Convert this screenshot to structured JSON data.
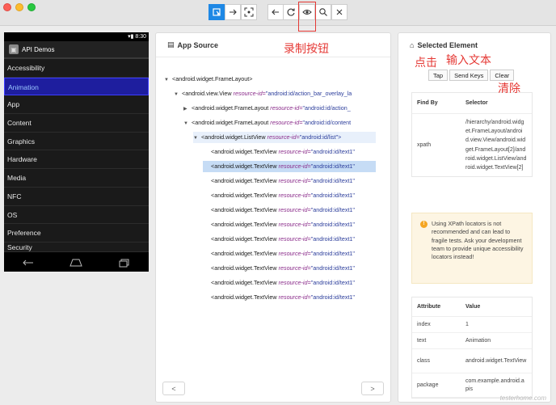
{
  "toolbar": {
    "buttons": [
      {
        "name": "select-elements",
        "icon": "select-icon",
        "active": true
      },
      {
        "name": "swipe",
        "icon": "arrow-right-icon"
      },
      {
        "name": "tap-coordinates",
        "icon": "crosshair-icon"
      },
      {
        "name": "back",
        "icon": "back-arrow-icon"
      },
      {
        "name": "refresh",
        "icon": "refresh-icon"
      },
      {
        "name": "recorder",
        "icon": "eye-icon"
      },
      {
        "name": "search",
        "icon": "search-icon"
      },
      {
        "name": "quit",
        "icon": "close-icon"
      }
    ]
  },
  "device": {
    "status_time": "8:30",
    "app_title": "API Demos",
    "items": [
      "Accessibility",
      "Animation",
      "App",
      "Content",
      "Graphics",
      "Hardware",
      "Media",
      "NFC",
      "OS",
      "Preference",
      "Security"
    ],
    "selected_index": 1
  },
  "source": {
    "title": "App Source",
    "nodes": [
      {
        "caret": "▼",
        "tag": "<android.widget.FrameLayout>",
        "attr": "",
        "val": ""
      },
      {
        "caret": "▼",
        "tag": "<android.view.View ",
        "attr": "resource-id=",
        "val": "\"android:id/action_bar_overlay_la"
      },
      {
        "caret": "▶",
        "tag": "<android.widget.FrameLayout ",
        "attr": "resource-id=",
        "val": "\"android:id/action_"
      },
      {
        "caret": "▼",
        "tag": "<android.widget.FrameLayout ",
        "attr": "resource-id=",
        "val": "\"android:id/content"
      },
      {
        "caret": "▼",
        "tag": "<android.widget.ListView ",
        "attr": "resource-id=",
        "val": "\"android:id/list\">"
      },
      {
        "caret": "",
        "tag": "<android.widget.TextView ",
        "attr": "resource-id=",
        "val": "\"android:id/text1\""
      },
      {
        "caret": "",
        "tag": "<android.widget.TextView ",
        "attr": "resource-id=",
        "val": "\"android:id/text1\""
      },
      {
        "caret": "",
        "tag": "<android.widget.TextView ",
        "attr": "resource-id=",
        "val": "\"android:id/text1\""
      },
      {
        "caret": "",
        "tag": "<android.widget.TextView ",
        "attr": "resource-id=",
        "val": "\"android:id/text1\""
      },
      {
        "caret": "",
        "tag": "<android.widget.TextView ",
        "attr": "resource-id=",
        "val": "\"android:id/text1\""
      },
      {
        "caret": "",
        "tag": "<android.widget.TextView ",
        "attr": "resource-id=",
        "val": "\"android:id/text1\""
      },
      {
        "caret": "",
        "tag": "<android.widget.TextView ",
        "attr": "resource-id=",
        "val": "\"android:id/text1\""
      },
      {
        "caret": "",
        "tag": "<android.widget.TextView ",
        "attr": "resource-id=",
        "val": "\"android:id/text1\""
      },
      {
        "caret": "",
        "tag": "<android.widget.TextView ",
        "attr": "resource-id=",
        "val": "\"android:id/text1\""
      },
      {
        "caret": "",
        "tag": "<android.widget.TextView ",
        "attr": "resource-id=",
        "val": "\"android:id/text1\""
      },
      {
        "caret": "",
        "tag": "<android.widget.TextView ",
        "attr": "resource-id=",
        "val": "\"android:id/text1\""
      }
    ],
    "prev_label": "<",
    "next_label": ">"
  },
  "element": {
    "title": "Selected Element",
    "actions": {
      "tap": "Tap",
      "send_keys": "Send Keys",
      "clear": "Clear"
    },
    "selector_table": {
      "headers": [
        "Find By",
        "Selector"
      ],
      "rows": [
        [
          "xpath",
          "/hierarchy/android.widget.FrameLayout/android.view.View/android.widget.FrameLayout[2]/android.widget.ListView/android.widget.TextView[2]"
        ]
      ]
    },
    "warning": "Using XPath locators is not recommended and can lead to fragile tests. Ask your development team to provide unique accessibility locators instead!",
    "attr_table": {
      "headers": [
        "Attribute",
        "Value"
      ],
      "rows": [
        [
          "index",
          "1"
        ],
        [
          "text",
          "Animation"
        ],
        [
          "class",
          "android.widget.TextView"
        ],
        [
          "package",
          "com.example.android.apis"
        ]
      ]
    }
  },
  "annotations": {
    "record": "录制按钮",
    "tap": "点击",
    "input": "输入文本",
    "clear": "清除"
  },
  "watermark": "testerhome.com"
}
